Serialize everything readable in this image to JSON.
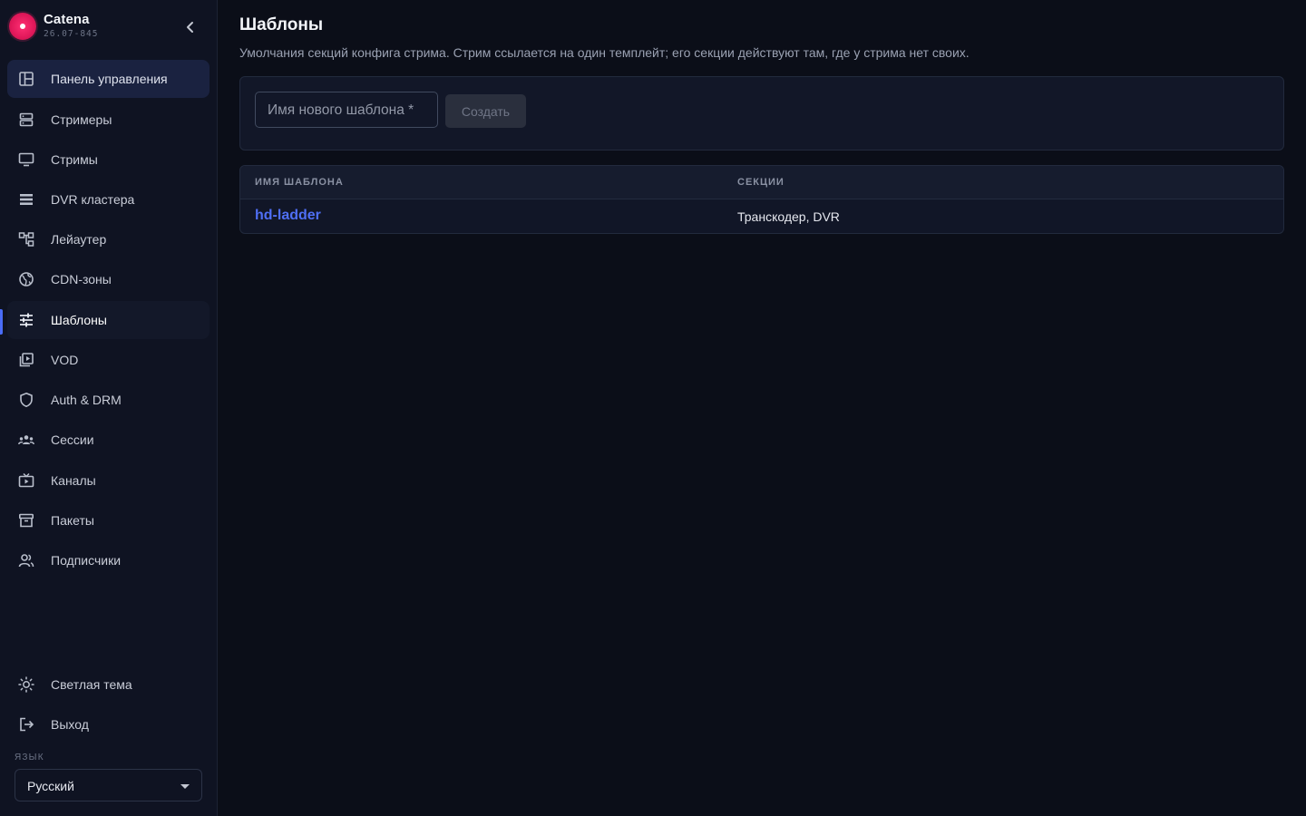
{
  "brand": {
    "name": "Catena",
    "version": "26.07-845"
  },
  "sidebar": {
    "items": [
      {
        "label": "Панель управления",
        "icon": "dashboard-icon"
      },
      {
        "label": "Стримеры",
        "icon": "server-icon"
      },
      {
        "label": "Стримы",
        "icon": "monitor-icon"
      },
      {
        "label": "DVR кластера",
        "icon": "storage-list-icon"
      },
      {
        "label": "Лейаутер",
        "icon": "layout-tree-icon"
      },
      {
        "label": "CDN-зоны",
        "icon": "globe-icon"
      },
      {
        "label": "Шаблоны",
        "icon": "sliders-icon"
      },
      {
        "label": "VOD",
        "icon": "video-library-icon"
      },
      {
        "label": "Auth & DRM",
        "icon": "shield-icon"
      },
      {
        "label": "Сессии",
        "icon": "group-icon"
      },
      {
        "label": "Каналы",
        "icon": "tv-icon"
      },
      {
        "label": "Пакеты",
        "icon": "archive-icon"
      },
      {
        "label": "Подписчики",
        "icon": "users-icon"
      }
    ],
    "footer": [
      {
        "label": "Светлая тема",
        "icon": "sun-icon"
      },
      {
        "label": "Выход",
        "icon": "logout-icon"
      }
    ],
    "language_label": "ЯЗЫК",
    "language_value": "Русский"
  },
  "page": {
    "title": "Шаблоны",
    "description": "Умолчания секций конфига стрима. Стрим ссылается на один темплейт; его секции действуют там, где у стрима нет своих.",
    "new_template_placeholder": "Имя нового шаблона *",
    "create_label": "Создать"
  },
  "table": {
    "columns": [
      "ИМЯ ШАБЛОНА",
      "СЕКЦИИ"
    ],
    "rows": [
      {
        "name": "hd-ladder",
        "sections": "Транскодер, DVR"
      }
    ]
  },
  "colors": {
    "accent": "#4a6cf7",
    "brand": "#e0185a",
    "background": "#0b0e18",
    "sidebar": "#0f1322"
  }
}
